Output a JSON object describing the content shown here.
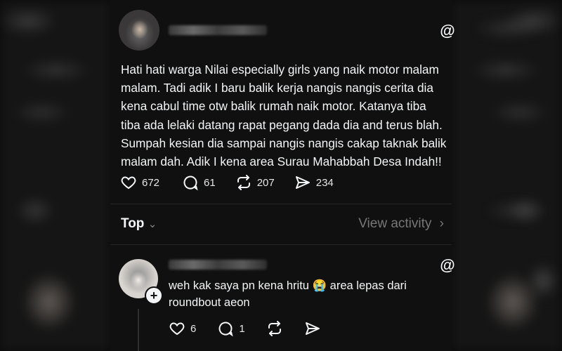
{
  "post": {
    "timestamp_blurred": "15h",
    "text_lines": [
      "Hati hati warga Nilai especially girls yang naik motor malam",
      "malam. Tadi adik I baru balik kerja nangis nangis cerita dia",
      "kena cabul time otw balik rumah naik motor. Katanya tiba",
      "tiba ada lelaki datang rapat pegang dada dia and terus blah.",
      "Sumpah kesian dia sampai nangis nangis cakap taknak balik",
      "malam dah. Adik I kena area Surau Mahabbah Desa Indah!!"
    ],
    "likes": "672",
    "comments": "61",
    "reposts": "207",
    "shares": "234"
  },
  "sort": {
    "label": "Top",
    "view_activity": "View activity"
  },
  "reply": {
    "username_blurred": "mkt",
    "text_line1": "weh kak saya pn kena hritu",
    "emoji": "😭",
    "text_line1b": " area lepas dari",
    "text_line2": "roundbout aeon",
    "likes": "6",
    "comments": "1"
  },
  "icons": {
    "threads": "threads-at-icon",
    "heart": "heart-icon",
    "comment": "comment-bubble-icon",
    "repost": "repost-icon",
    "share": "send-icon",
    "chevron_down": "chevron-down-icon",
    "chevron_right": "chevron-right-icon",
    "follow_plus": "plus-icon"
  }
}
